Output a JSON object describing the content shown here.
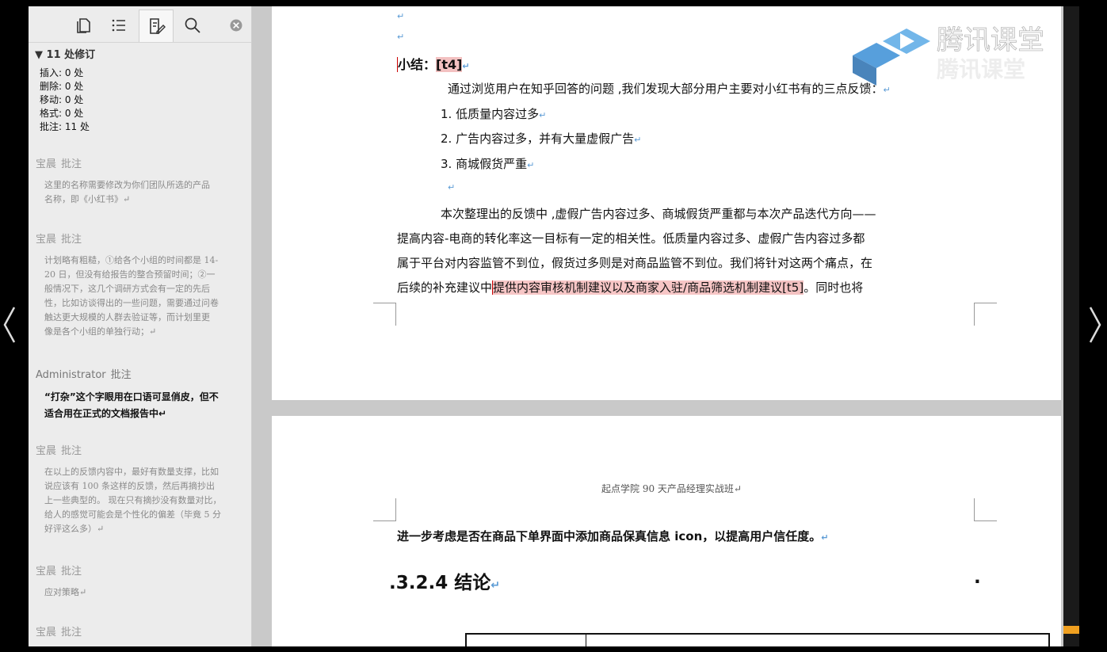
{
  "sidebar": {
    "tab_icons": [
      "pages-icon",
      "list-icon",
      "edit-icon",
      "search-icon",
      "close-icon"
    ],
    "revision_header": "▼ 11 处修订",
    "stats": [
      "插入: 0 处",
      "删除: 0 处",
      "移动: 0 处",
      "格式: 0 处",
      "批注: 11 处"
    ],
    "comments": [
      {
        "author": "宝晨",
        "label": "批注",
        "lines": [
          "这里的名称需要修改为你们团队所选的产品",
          "名称，即《小红书》↵"
        ]
      },
      {
        "author": "宝晨",
        "label": "批注",
        "lines": [
          "计划略有粗糙，①给各个小组的时间都是 14-",
          "20 日，但没有给报告的整合预留时间；②一",
          "般情况下，这几个调研方式会有一定的先后",
          "性，比如访谈得出的一些问题，需要通过问卷",
          "触达更大规模的人群去验证等，而计划里更",
          "像是各个小组的单独行动；↵"
        ]
      },
      {
        "author": "Administrator",
        "label": "批注",
        "lines": [
          "“打杂”这个字眼用在口语可显俏皮，但不",
          "适合用在正式的文档报告中↵"
        ]
      },
      {
        "author": "宝晨",
        "label": "批注",
        "lines": [
          "在以上的反馈内容中，最好有数量支撑，比如",
          "说应该有 100 条这样的反馈，然后再摘抄出",
          "上一些典型的。 现在只有摘抄没有数量对比，",
          "给人的感觉可能会是个性化的偏差（毕竟 5 分",
          "好评这么多）↵"
        ]
      },
      {
        "author": "宝晨",
        "label": "批注",
        "lines": [
          "应对策略↵"
        ]
      },
      {
        "author": "宝晨",
        "label": "批注",
        "lines": []
      }
    ]
  },
  "document": {
    "summary_title": "小结：",
    "summary_tag": "[t4]",
    "intro": "通过浏览用户在知乎回答的问题 ,我们发现大部分用户主要对小红书有的三点反馈：",
    "items": [
      "1.  低质量内容过多",
      "2.  广告内容过多，并有大量虚假广告",
      "3.  商城假货严重"
    ],
    "para_lines": [
      "本次整理出的反馈中 ,虚假广告内容过多、商城假货严重都与本次产品迭代方向——",
      "提高内容-电商的转化率这一目标有一定的相关性。低质量内容过多、虚假广告内容过多都",
      "属于平台对内容监管不到位，假货过多则是对商品监管不到位。我们将针对这两个痛点，在"
    ],
    "last_line_pre": "后续的补充建议中",
    "last_line_hl": "提供内容审核机制建议以及商家入驻/商品筛选机制建议",
    "last_line_tag": "[t5]",
    "last_line_post": "。同时也将",
    "page2_header": "起点学院 90 天产品经理实战班↵",
    "page2_line": "进一步考虑是否在商品下单界面中添加商品保真信息 icon，以提高用户信任度。",
    "heading": "3.2.4  结论",
    "return_mark": "↵"
  },
  "watermark": {
    "text": "腾讯课堂"
  }
}
